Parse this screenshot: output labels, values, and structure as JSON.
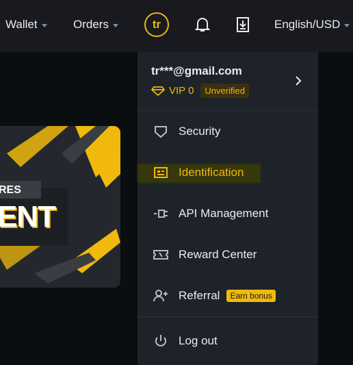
{
  "nav": {
    "wallet": "Wallet",
    "orders": "Orders",
    "avatar_initials": "tr",
    "language": "English/USD"
  },
  "banner": {
    "line1": "RES",
    "line2": "ENT"
  },
  "account": {
    "email": "tr***@gmail.com",
    "vip": "VIP 0",
    "status": "Unverified"
  },
  "menu": {
    "items": [
      {
        "label": "Security",
        "icon": "shield-icon"
      },
      {
        "label": "Identification",
        "icon": "id-card-icon"
      },
      {
        "label": "API Management",
        "icon": "api-key-icon"
      },
      {
        "label": "Reward Center",
        "icon": "ticket-icon"
      },
      {
        "label": "Referral",
        "icon": "add-user-icon",
        "badge": "Earn bonus"
      },
      {
        "label": "Log out",
        "icon": "power-icon"
      }
    ]
  },
  "colors": {
    "accent": "#f0b90b",
    "bg": "#0b0e11",
    "panel": "#1e2329",
    "topbar": "#181a20"
  }
}
